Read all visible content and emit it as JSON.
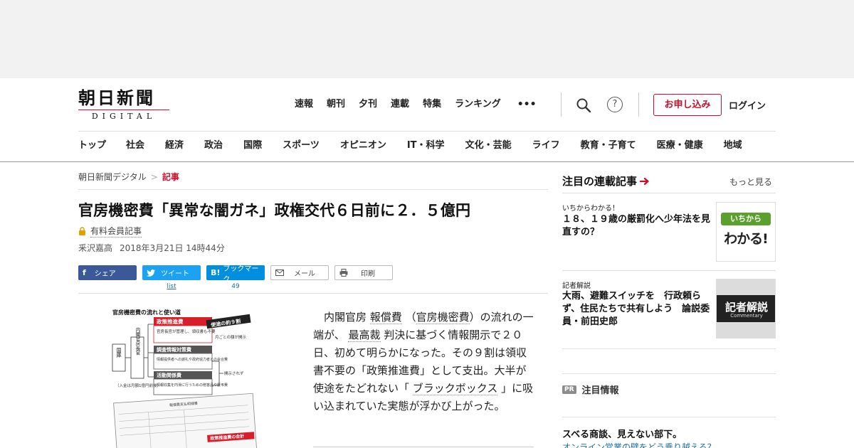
{
  "brand": {
    "name_main": "朝日新聞",
    "name_sub": "DIGITAL"
  },
  "topnav": [
    "速報",
    "朝刊",
    "夕刊",
    "連載",
    "特集",
    "ランキング"
  ],
  "topnav_more": "•••",
  "help_glyph": "?",
  "subscribe_label": "お申し込み",
  "login_label": "ログイン",
  "catnav": [
    "トップ",
    "社会",
    "経済",
    "政治",
    "国際",
    "スポーツ",
    "オピニオン",
    "IT・科学",
    "文化・芸能",
    "ライフ",
    "教育・子育て",
    "医療・健康",
    "地域"
  ],
  "breadcrumb": {
    "home": "朝日新聞デジタル",
    "sep": ">",
    "current": "記事"
  },
  "article": {
    "title": "官房機密費「異常な闇ガネ」政権交代６日前に２．５億円",
    "premium": "有料会員記事",
    "author": "釆沢嘉高",
    "date": "2018年3月21日 14時44分",
    "body": {
      "p1": "内閣官房",
      "l1": "報償費",
      "p2": "（",
      "l2": "官房機密費",
      "p3": "）の流れの一端が、",
      "l3": "最高裁",
      "p4": "判決に基づく情報開示で２０日、初めて明らかになった。その９割は領収書不要の「政策推進費」として支出。大半が使途をたどれない「",
      "l4": "ブラックボックス",
      "p5": "」に吸い込まれていた実態が浮かび上がった。"
    }
  },
  "share": {
    "facebook": "シェア",
    "twitter": "ツイート",
    "twitter_count": "list",
    "hatena": "ブックマーク",
    "hatena_count": "49",
    "mail": "メール",
    "print": "印刷"
  },
  "figure": {
    "title": "官房機密費の流れと使い道",
    "kokko": "国庫",
    "chokan": "内閣官房長官",
    "box1_head": "政策推進費",
    "box1_body": "官房長官が管理し、領収書も不要",
    "box2_head": "調査情報対策費",
    "box2_body": "情報提供者への謝礼や政府協力者との会合費",
    "box3_head": "活動関係費",
    "box3_body": "情報収集を円滑に行うための贈答品や慶弔費",
    "tag": "使途の約９割",
    "monthly": "月ごとの額が開示",
    "undisclosed": "開示されず",
    "deposit": "（入金は月額1億円前後）",
    "doc_title": "報償費支払明細書",
    "red_label": "政策推進費の合計"
  },
  "sidebar": {
    "title": "注目の連載記事",
    "more": "もっと見る",
    "cards": [
      {
        "kicker": "いちからわかる！",
        "title": "１８、１９歳の厳罰化へ少年法を見直すの？",
        "thumb_top": "いちから",
        "thumb_bottom": "わかる!"
      },
      {
        "kicker": "記者解説",
        "title": "大雨、避難スイッチを　行政頼らず、住民たちで共有しよう　論説委員・前田史郎",
        "thumb_top": "記者解説",
        "thumb_bottom": "Commentary"
      }
    ],
    "pr_badge": "PR",
    "pr_label": "注目情報",
    "pr_title": "スベる商談、見えない部下。",
    "pr_sub": "オンライン営業の壁をどう乗り越える？"
  },
  "colors": {
    "brand_red": "#c8102e",
    "link_blue": "#1d6fa5",
    "thumb_green": "#5aa02c"
  }
}
